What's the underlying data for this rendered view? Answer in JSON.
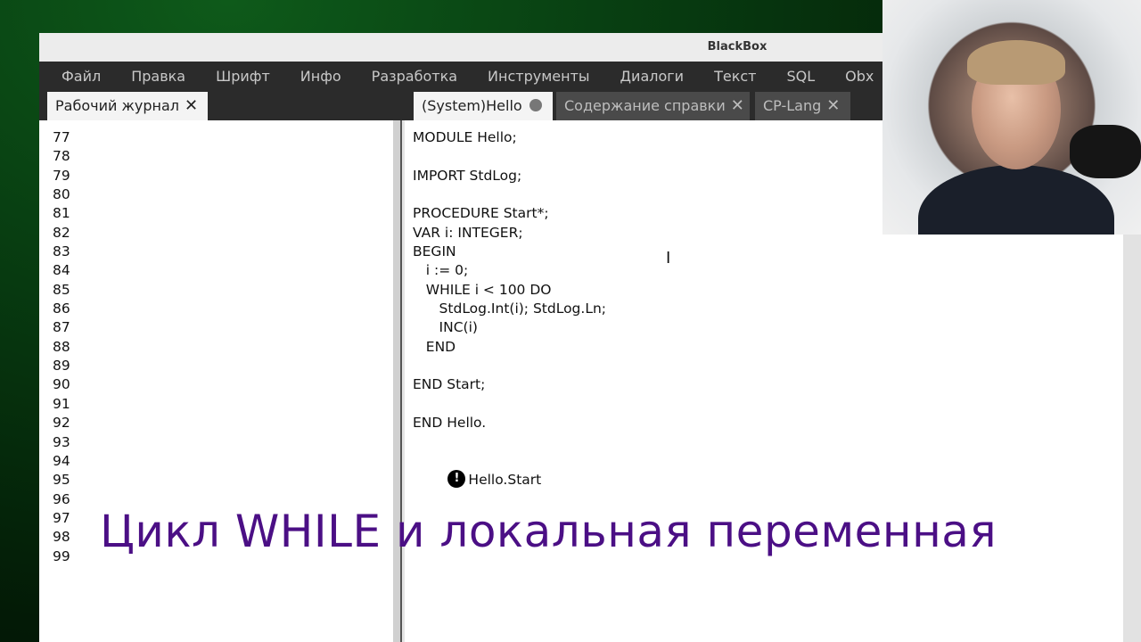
{
  "window": {
    "title": "BlackBox"
  },
  "menu": [
    {
      "label": "Файл"
    },
    {
      "label": "Правка"
    },
    {
      "label": "Шрифт"
    },
    {
      "label": "Инфо"
    },
    {
      "label": "Разработка"
    },
    {
      "label": "Инструменты"
    },
    {
      "label": "Диалоги"
    },
    {
      "label": "Текст"
    },
    {
      "label": "SQL"
    },
    {
      "label": "Obx"
    }
  ],
  "tabs": {
    "log": {
      "label": "Рабочий журнал",
      "close_icon": "close-icon"
    },
    "hello": {
      "label": "(System)Hello",
      "modified_icon": "modified-dot-icon"
    },
    "help": {
      "label": "Содержание справки",
      "close_icon": "close-icon"
    },
    "cplang": {
      "label": "CP-Lang",
      "close_icon": "close-icon"
    }
  },
  "log": {
    "lines": [
      "77",
      "78",
      "79",
      "80",
      "81",
      "82",
      "83",
      "84",
      "85",
      "86",
      "87",
      "88",
      "89",
      "90",
      "91",
      "92",
      "93",
      "94",
      "95",
      "96",
      "97",
      "98",
      "99"
    ]
  },
  "editor": {
    "code_lines": [
      "MODULE Hello;",
      "",
      "IMPORT StdLog;",
      "",
      "PROCEDURE Start*;",
      "VAR i: INTEGER;",
      "BEGIN",
      "   i := 0;",
      "   WHILE i < 100 DO",
      "      StdLog.Int(i); StdLog.Ln;",
      "      INC(i)",
      "   END",
      "",
      "END Start;",
      "",
      "END Hello.",
      ""
    ],
    "commander_icon": "!",
    "command": "Hello.Start"
  },
  "caption": "Цикл WHILE и локальная переменная",
  "colors": {
    "caption": "#4b0f85",
    "menubar": "#2b2b2b"
  }
}
